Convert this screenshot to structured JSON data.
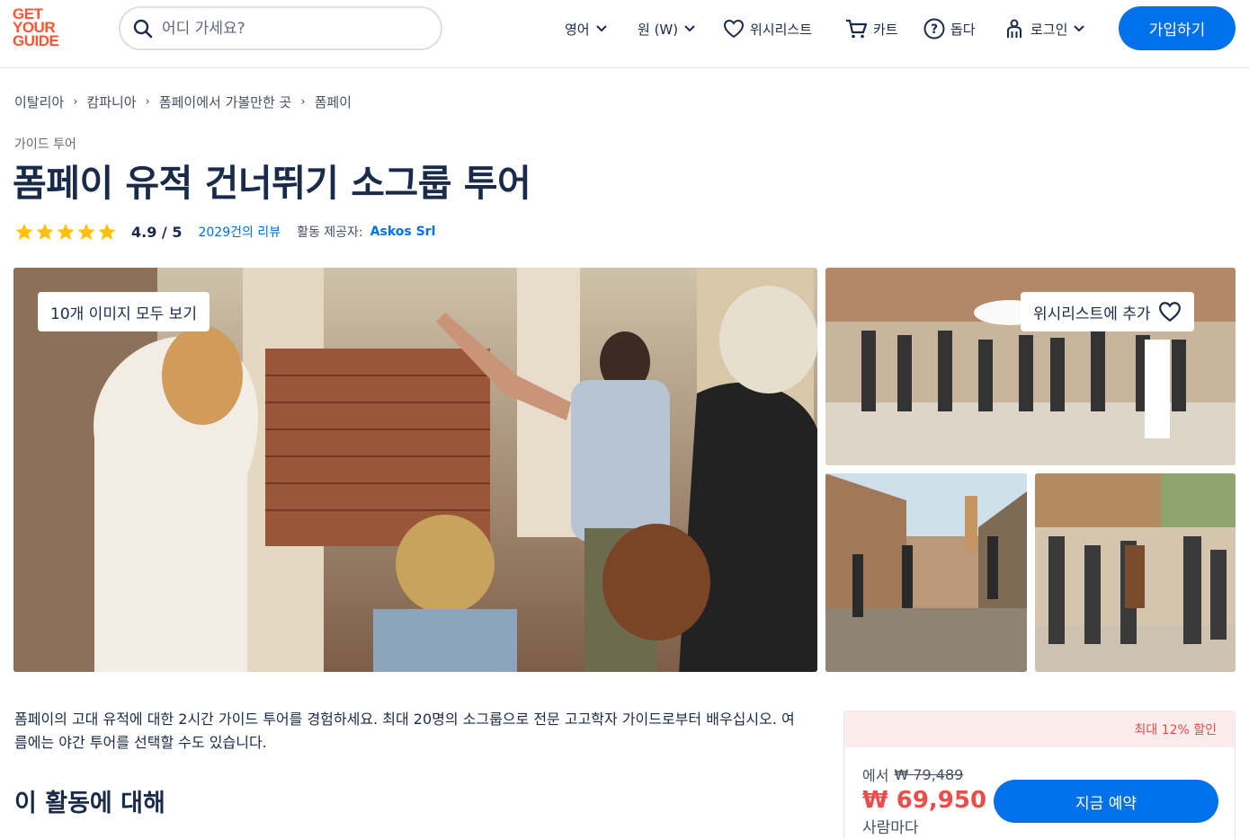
{
  "brand": {
    "logo_lines": [
      "GET",
      "YOUR",
      "GUIDE"
    ],
    "color": "#ff5533"
  },
  "search": {
    "placeholder": "어디 가세요?"
  },
  "nav": {
    "language": "영어",
    "currency": "원 (W)",
    "wishlist": "위시리스트",
    "cart": "카트",
    "help": "돕다",
    "login": "로그인",
    "signup": "가입하기"
  },
  "breadcrumb": [
    "이탈리아",
    "캄파니아",
    "폼페이에서 가볼만한 곳",
    "폼페이"
  ],
  "activity": {
    "category": "가이드 투어",
    "title": "폼페이 유적 건너뛰기 소그룹 투어",
    "stars": 5,
    "rating": "4.9 / 5",
    "reviews": "2029건의 리뷰",
    "provider_label": "활동 제공자:",
    "provider": "Askos Srl"
  },
  "gallery": {
    "all_images": "10개 이미지 모두 보기",
    "add_wishlist": "위시리스트에 추가"
  },
  "description": "폼페이의 고대 유적에 대한 2시간 가이드 투어를 경험하세요. 최대 20명의 소그룹으로 전문 고고학자 가이드로부터 배우십시오. 여름에는 야간 투어를 선택할 수도 있습니다.",
  "about_heading": "이 활동에 대해",
  "booking": {
    "discount": "최대 12% 할인",
    "from": "에서",
    "old_price": "₩ 79,489",
    "price": "₩ 69,950",
    "per_person": "사람마다",
    "book_now": "지금 예약"
  },
  "colors": {
    "accent": "#0071eb",
    "text": "#1a2b49",
    "sale": "#eb4d4b",
    "star": "#ffc107"
  }
}
